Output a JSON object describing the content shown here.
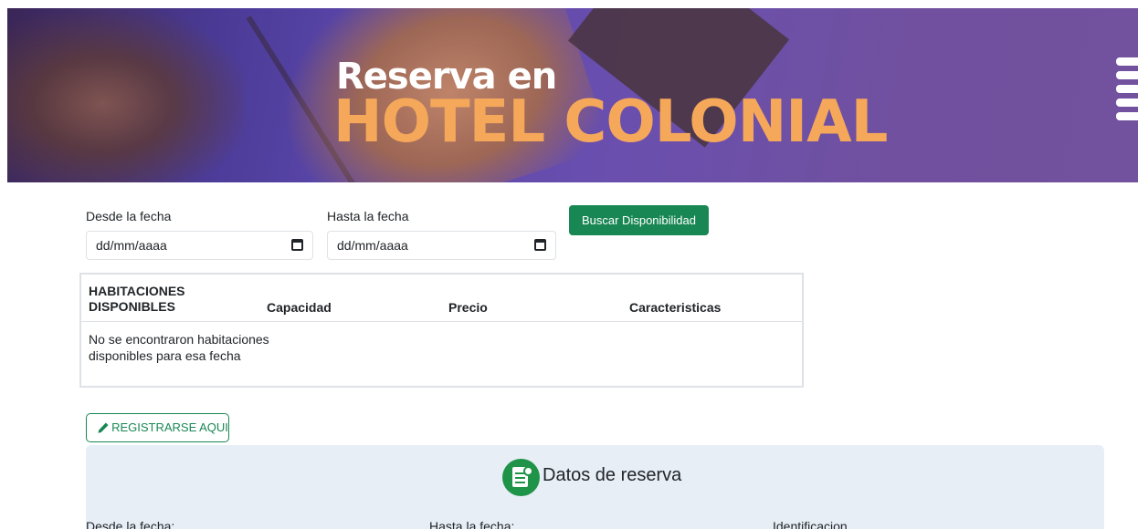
{
  "banner": {
    "line1": "Reserva en",
    "line2": "HOTEL COLONIAL"
  },
  "search": {
    "from_label": "Desde la fecha",
    "from_value": "dd/mm/aaaa",
    "to_label": "Hasta la fecha",
    "to_value": "dd/mm/aaaa",
    "button_label": "Buscar Disponibilidad"
  },
  "rooms_table": {
    "headers": [
      "HABITACIONES DISPONIBLES",
      "Capacidad",
      "Precio",
      "Caracteristicas"
    ],
    "empty_message": "No se encontraron habitaciones disponibles para esa fecha"
  },
  "register": {
    "button_label": "REGISTRARSE AQUI",
    "icon": "pencil-icon"
  },
  "reservation": {
    "title": "Datos de reserva",
    "icon": "calendar-check-icon",
    "from_label": "Desde la fecha:",
    "to_label": "Hasta la fecha:",
    "id_label": "Identificacion"
  },
  "colors": {
    "accent_green": "#198754",
    "banner_purple": "#6a4fae",
    "banner_orange_text": "#f6a85a",
    "panel_bg": "#e8eef6"
  }
}
